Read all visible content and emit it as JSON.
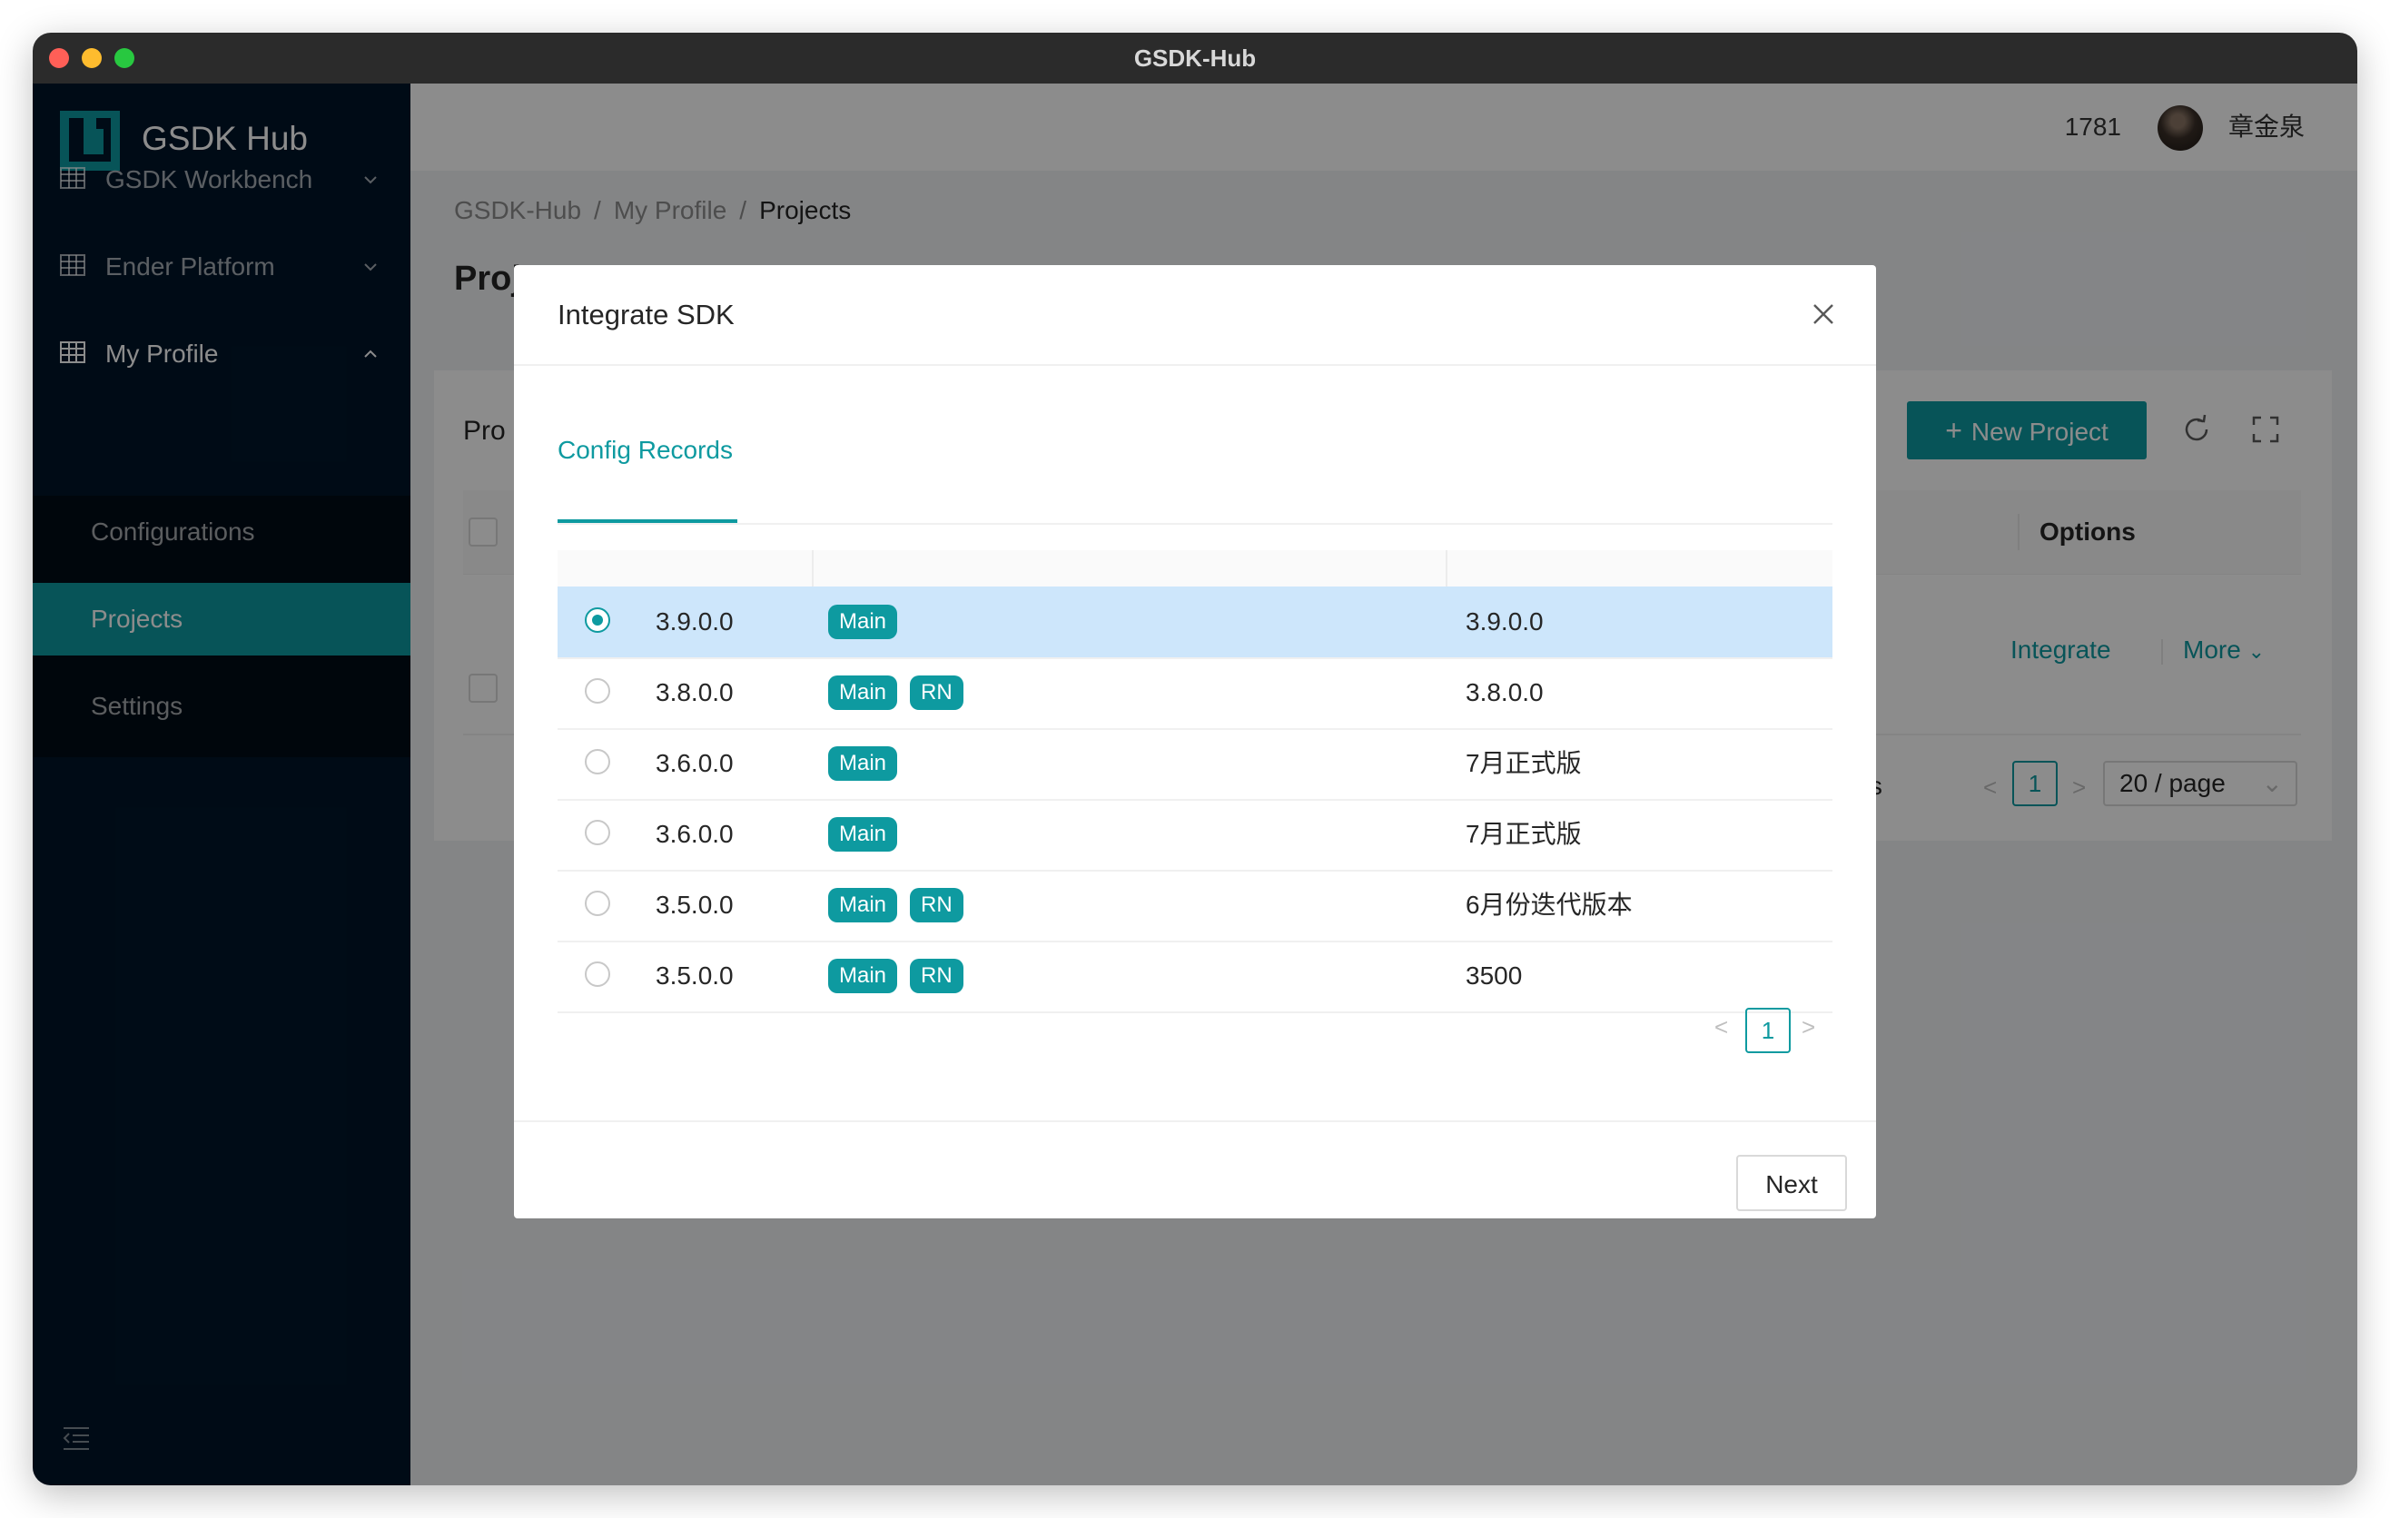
{
  "window": {
    "title": "GSDK-Hub"
  },
  "sidebar": {
    "logo_text": "GSDK Hub",
    "menus": [
      {
        "label": "GSDK Workbench",
        "icon": "table-icon",
        "expanded": false
      },
      {
        "label": "Ender Platform",
        "icon": "table-icon",
        "expanded": false
      },
      {
        "label": "My Profile",
        "icon": "table-icon",
        "expanded": true
      }
    ],
    "submenu": [
      {
        "label": "Configurations",
        "active": false
      },
      {
        "label": "Projects",
        "active": true
      },
      {
        "label": "Settings",
        "active": false
      }
    ]
  },
  "header": {
    "number": "1781",
    "user": "章金泉"
  },
  "breadcrumb": {
    "items": [
      "GSDK-Hub",
      "My Profile",
      "Projects"
    ],
    "separator": "/"
  },
  "page": {
    "title": "Proj"
  },
  "card": {
    "title": "Pro",
    "new_project": "New Project",
    "column_options": "Options",
    "action_integrate": "Integrate",
    "action_more": "More",
    "pagination": {
      "items_text": "ems",
      "current": "1",
      "page_size": "20 / page"
    }
  },
  "modal": {
    "title": "Integrate SDK",
    "tab": "Config Records",
    "rows": [
      {
        "version": "3.9.0.0",
        "tags": [
          "Main"
        ],
        "desc": "3.9.0.0",
        "selected": true
      },
      {
        "version": "3.8.0.0",
        "tags": [
          "Main",
          "RN"
        ],
        "desc": "3.8.0.0",
        "selected": false
      },
      {
        "version": "3.6.0.0",
        "tags": [
          "Main"
        ],
        "desc": "7月正式版",
        "selected": false
      },
      {
        "version": "3.6.0.0",
        "tags": [
          "Main"
        ],
        "desc": "7月正式版",
        "selected": false
      },
      {
        "version": "3.5.0.0",
        "tags": [
          "Main",
          "RN"
        ],
        "desc": "6月份迭代版本",
        "selected": false
      },
      {
        "version": "3.5.0.0",
        "tags": [
          "Main",
          "RN"
        ],
        "desc": "3500",
        "selected": false
      }
    ],
    "pagination": {
      "current": "1"
    },
    "next_label": "Next"
  },
  "colors": {
    "accent": "#0e9aa0",
    "sidebar_bg": "#001529",
    "selected_row": "#cde6fb"
  }
}
